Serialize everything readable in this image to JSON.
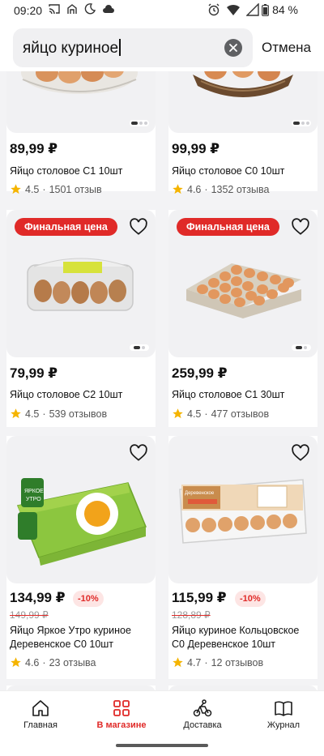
{
  "status": {
    "time": "09:20",
    "battery": "84 %"
  },
  "search": {
    "query": "яйцо куриное",
    "cancel_label": "Отмена"
  },
  "products": [
    {
      "price": "89,99 ₽",
      "name": "Яйцо столовое С1 10шт",
      "rating": "4.5",
      "reviews": "1501 отзыв"
    },
    {
      "price": "99,99 ₽",
      "name": "Яйцо столовое С0 10шт",
      "rating": "4.6",
      "reviews": "1352 отзыва"
    },
    {
      "badge": "Финальная цена",
      "price": "79,99 ₽",
      "name": "Яйцо столовое С2 10шт",
      "rating": "4.5",
      "reviews": "539 отзывов"
    },
    {
      "badge": "Финальная цена",
      "price": "259,99 ₽",
      "name": "Яйцо столовое С1 30шт",
      "rating": "4.5",
      "reviews": "477 отзывов"
    },
    {
      "price": "134,99 ₽",
      "old_price": "149,99 ₽",
      "discount": "-10%",
      "name": "Яйцо Яркое Утро куриное Деревенское С0 10шт",
      "rating": "4.6",
      "reviews": "23 отзыва"
    },
    {
      "price": "115,99 ₽",
      "old_price": "128,89 ₽",
      "discount": "-10%",
      "name": "Яйцо куриное Кольцовское С0 Деревенское 10шт",
      "rating": "4.7",
      "reviews": "12 отзывов"
    }
  ],
  "tabs": [
    {
      "label": "Главная",
      "icon": "home-icon"
    },
    {
      "label": "В магазине",
      "icon": "store-grid-icon",
      "active": true
    },
    {
      "label": "Доставка",
      "icon": "courier-bike-icon"
    },
    {
      "label": "Журнал",
      "icon": "book-icon"
    }
  ],
  "colors": {
    "accent": "#e02a28",
    "star": "#f5b400"
  }
}
